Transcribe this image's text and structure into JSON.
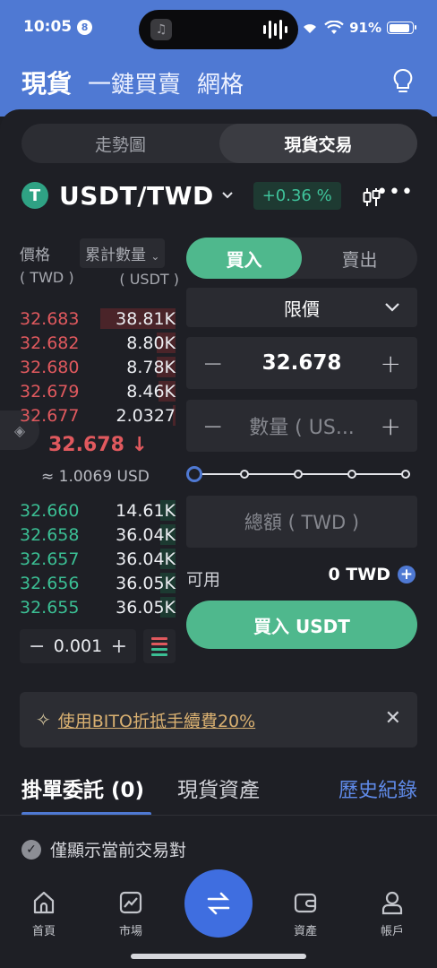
{
  "status": {
    "time": "10:05",
    "notif_badge": "8",
    "battery": "91%"
  },
  "header": {
    "tabs": [
      "現貨",
      "一鍵買賣",
      "網格"
    ]
  },
  "segment": {
    "chart": "走勢圖",
    "spot": "現貨交易"
  },
  "pair": {
    "symbol": "USDT/TWD",
    "coin_letter": "T",
    "change": "+0.36 %"
  },
  "orderbook": {
    "price_label": "價格",
    "price_unit": "( TWD )",
    "qty_label": "累計數量",
    "qty_unit": "( USDT )",
    "asks": [
      {
        "price": "32.683",
        "qty": "38.81K",
        "depth": 0.48
      },
      {
        "price": "32.682",
        "qty": "8.80K",
        "depth": 0.12
      },
      {
        "price": "32.680",
        "qty": "8.78K",
        "depth": 0.12
      },
      {
        "price": "32.679",
        "qty": "8.46K",
        "depth": 0.11
      },
      {
        "price": "32.677",
        "qty": "2.0327",
        "depth": 0.02
      }
    ],
    "last_price": "32.678 ↓",
    "last_usd": "≈ 1.0069 USD",
    "bids": [
      {
        "price": "32.660",
        "qty": "14.61K",
        "depth": 0.1
      },
      {
        "price": "32.658",
        "qty": "36.04K",
        "depth": 0.1
      },
      {
        "price": "32.657",
        "qty": "36.04K",
        "depth": 0.1
      },
      {
        "price": "32.656",
        "qty": "36.05K",
        "depth": 0.1
      },
      {
        "price": "32.655",
        "qty": "36.05K",
        "depth": 0.1
      }
    ],
    "step_minus": "−",
    "step_value": "0.001",
    "step_plus": "+"
  },
  "form": {
    "buy": "買入",
    "sell": "賣出",
    "order_type": "限價",
    "minus": "−",
    "plus": "+",
    "price": "32.678",
    "qty_placeholder": "數量 ( US...",
    "slider_percent": 0,
    "total_placeholder": "總額 ( TWD )",
    "available_label": "可用",
    "available_value": "0 TWD",
    "buy_button": "買入 USDT"
  },
  "promo": {
    "text": "使用BITO折抵手續費20%"
  },
  "orders": {
    "open": "掛單委託 (0)",
    "assets": "現貨資產",
    "history": "歷史紀錄",
    "only_current": "僅顯示當前交易對"
  },
  "nav": {
    "home": "首頁",
    "market": "市場",
    "assets": "資產",
    "account": "帳戶"
  },
  "colors": {
    "brand_blue": "#4f79d3",
    "buy_green": "#4fb88d",
    "ask_red": "#e0595e",
    "bid_green": "#3bbf94"
  }
}
